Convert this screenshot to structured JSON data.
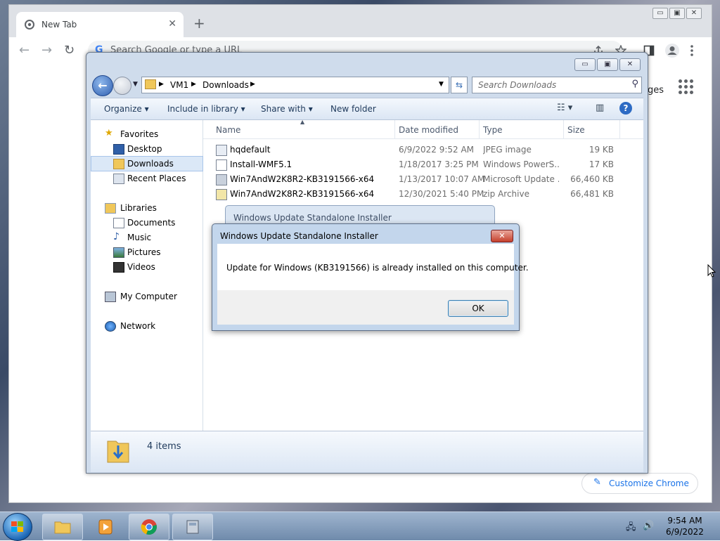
{
  "chrome": {
    "tab_title": "New Tab",
    "tab_close": "✕",
    "new_tab": "+",
    "window_buttons": [
      "▭",
      "▣",
      "✕"
    ],
    "back": "←",
    "forward": "→",
    "reload": "↻",
    "omnibox_placeholder": "Search Google or type a URL",
    "images_link": "ges",
    "customize_label": "Customize Chrome",
    "customize_icon": "✎"
  },
  "explorer": {
    "window_buttons": [
      "▭",
      "▣",
      "✕"
    ],
    "breadcrumb": [
      "VM1",
      "Downloads"
    ],
    "search_placeholder": "Search Downloads",
    "commands": {
      "organize": "Organize",
      "include": "Include in library",
      "share": "Share with",
      "new_folder": "New folder"
    },
    "nav": {
      "favorites": "Favorites",
      "desktop": "Desktop",
      "downloads": "Downloads",
      "recent": "Recent Places",
      "libraries": "Libraries",
      "documents": "Documents",
      "music": "Music",
      "pictures": "Pictures",
      "videos": "Videos",
      "computer": "My Computer",
      "network": "Network"
    },
    "columns": {
      "name": "Name",
      "date": "Date modified",
      "type": "Type",
      "size": "Size"
    },
    "files": [
      {
        "name": "hqdefault",
        "date": "6/9/2022 9:52 AM",
        "type": "JPEG image",
        "size": "19 KB"
      },
      {
        "name": "Install-WMF5.1",
        "date": "1/18/2017 3:25 PM",
        "type": "Windows PowerS...",
        "size": "17 KB"
      },
      {
        "name": "Win7AndW2K8R2-KB3191566-x64",
        "date": "1/13/2017 10:07 AM",
        "type": "Microsoft Update ...",
        "size": "66,460 KB"
      },
      {
        "name": "Win7AndW2K8R2-KB3191566-x64",
        "date": "12/30/2021 5:40 PM",
        "type": "zip Archive",
        "size": "66,481 KB"
      }
    ],
    "item_count": "4 items"
  },
  "ghost_dialog": {
    "title": "Windows Update Standalone Installer"
  },
  "dialog": {
    "title": "Windows Update Standalone Installer",
    "close": "✕",
    "message": "Update for Windows (KB3191566) is already installed on this computer.",
    "ok": "OK"
  },
  "taskbar": {
    "time": "9:54 AM",
    "date": "6/9/2022"
  }
}
